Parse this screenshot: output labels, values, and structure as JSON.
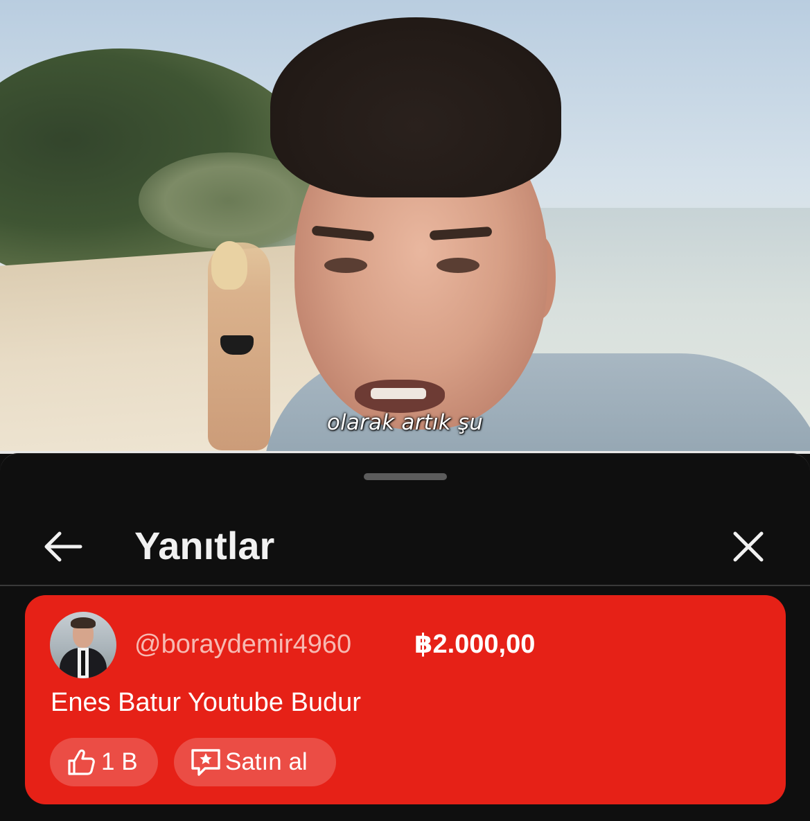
{
  "video": {
    "subtitle": "olarak artık şu"
  },
  "sheet": {
    "title": "Yanıtlar",
    "back_icon": "arrow-left-icon",
    "close_icon": "close-icon"
  },
  "super_chat": {
    "card_color": "#e62117",
    "username": "@boraydemir4960",
    "amount": "฿2.000,00",
    "text": "Enes Batur Youtube Budur",
    "like_count": "1 B",
    "like_icon": "thumbs-up-icon",
    "buy_label": "Satın al",
    "buy_icon": "super-chat-icon"
  }
}
